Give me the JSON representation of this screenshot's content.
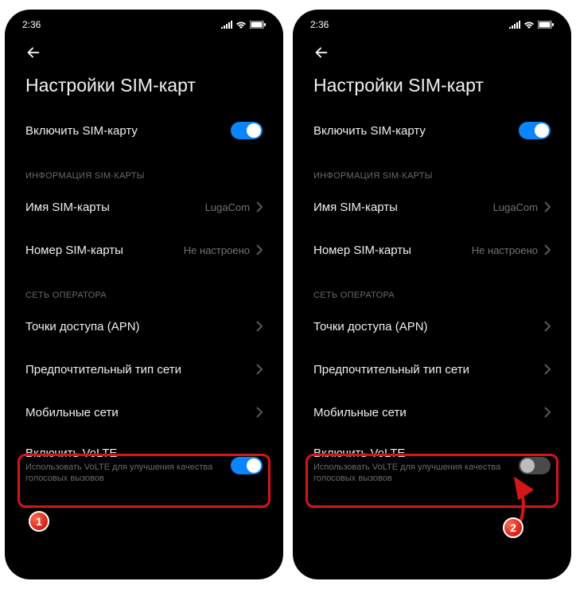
{
  "status": {
    "time": "2:36"
  },
  "page_title": "Настройки SIM-карт",
  "rows": {
    "enable_sim": {
      "label": "Включить SIM-карту"
    },
    "section_info": "ИНФОРМАЦИЯ SIM-КАРТЫ",
    "sim_name": {
      "label": "Имя SIM-карты",
      "value": "LugaCom"
    },
    "sim_number": {
      "label": "Номер SIM-карты",
      "value": "Не настроено"
    },
    "section_net": "СЕТЬ ОПЕРАТОРА",
    "apn": {
      "label": "Точки доступа (APN)"
    },
    "pref_net": {
      "label": "Предпочтительный тип сети"
    },
    "mobile_net": {
      "label": "Мобильные сети"
    },
    "volte": {
      "label": "Включить VoLTE",
      "sub": "Использовать VoLTE для улучшения качества голосовых вызовов"
    }
  },
  "callouts": {
    "one": "1",
    "two": "2"
  },
  "screens": [
    {
      "volte_on": true,
      "callout_key": "one"
    },
    {
      "volte_on": false,
      "callout_key": "two"
    }
  ]
}
